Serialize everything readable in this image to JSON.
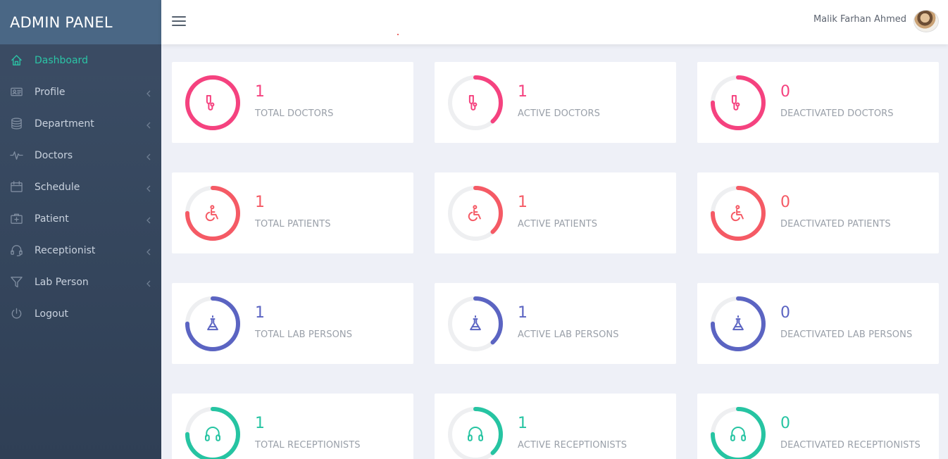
{
  "brand": "ADMIN PANEL",
  "user": {
    "name": "Malik Farhan Ahmed"
  },
  "nav": [
    {
      "label": "Dashboard",
      "icon": "home-icon",
      "active": true,
      "chevron": false
    },
    {
      "label": "Profile",
      "icon": "id-card-icon",
      "active": false,
      "chevron": true
    },
    {
      "label": "Department",
      "icon": "database-icon",
      "active": false,
      "chevron": true
    },
    {
      "label": "Doctors",
      "icon": "pulse-icon",
      "active": false,
      "chevron": true
    },
    {
      "label": "Schedule",
      "icon": "calendar-icon",
      "active": false,
      "chevron": true
    },
    {
      "label": "Patient",
      "icon": "medical-kit-icon",
      "active": false,
      "chevron": true
    },
    {
      "label": "Receptionist",
      "icon": "headset-icon",
      "active": false,
      "chevron": true
    },
    {
      "label": "Lab Person",
      "icon": "filter-icon",
      "active": false,
      "chevron": true
    },
    {
      "label": "Logout",
      "icon": "power-icon",
      "active": false,
      "chevron": false
    }
  ],
  "colors": {
    "doctors": "#f5427f",
    "patients": "#f55a65",
    "lab": "#5b64c2",
    "receptionists": "#26c4a2",
    "track": "#eeeff1",
    "accent": "#2bc5a6"
  },
  "stats": [
    {
      "group": "doctors",
      "icon": "stethoscope-icon",
      "count": "1",
      "label": "TOTAL DOCTORS",
      "fill": 1.0
    },
    {
      "group": "doctors",
      "icon": "stethoscope-icon",
      "count": "1",
      "label": "ACTIVE DOCTORS",
      "fill": 0.38
    },
    {
      "group": "doctors",
      "icon": "stethoscope-icon",
      "count": "0",
      "label": "DEACTIVATED DOCTORS",
      "fill": 0.75
    },
    {
      "group": "patients",
      "icon": "wheelchair-icon",
      "count": "1",
      "label": "TOTAL PATIENTS",
      "fill": 0.75
    },
    {
      "group": "patients",
      "icon": "wheelchair-icon",
      "count": "1",
      "label": "ACTIVE PATIENTS",
      "fill": 0.38
    },
    {
      "group": "patients",
      "icon": "wheelchair-icon",
      "count": "0",
      "label": "DEACTIVATED PATIENTS",
      "fill": 0.75
    },
    {
      "group": "lab",
      "icon": "flask-icon",
      "count": "1",
      "label": "TOTAL LAB PERSONS",
      "fill": 0.75
    },
    {
      "group": "lab",
      "icon": "flask-icon",
      "count": "1",
      "label": "ACTIVE LAB PERSONS",
      "fill": 0.38
    },
    {
      "group": "lab",
      "icon": "flask-icon",
      "count": "0",
      "label": "DEACTIVATED LAB PERSONS",
      "fill": 0.75
    },
    {
      "group": "receptionists",
      "icon": "headphones-icon",
      "count": "1",
      "label": "TOTAL RECEPTIONISTS",
      "fill": 0.75
    },
    {
      "group": "receptionists",
      "icon": "headphones-icon",
      "count": "1",
      "label": "ACTIVE RECEPTIONISTS",
      "fill": 0.38
    },
    {
      "group": "receptionists",
      "icon": "headphones-icon",
      "count": "0",
      "label": "DEACTIVATED RECEPTIONISTS",
      "fill": 0.75
    }
  ]
}
